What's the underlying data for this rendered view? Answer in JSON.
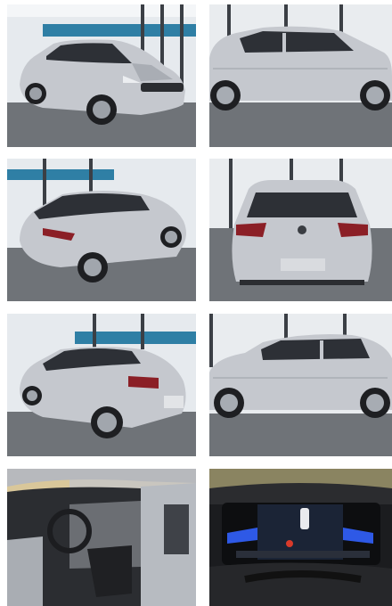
{
  "gallery": {
    "photos": [
      {
        "view": "front-left"
      },
      {
        "view": "side-right"
      },
      {
        "view": "rear-left"
      },
      {
        "view": "rear"
      },
      {
        "view": "rear-left-close"
      },
      {
        "view": "side-left"
      },
      {
        "view": "interior-driver-door"
      },
      {
        "view": "instrument-cluster"
      }
    ],
    "colors": {
      "car_silver": "#c3c6cc",
      "car_shadow": "#8e939b",
      "showroom_wall": "#e9ecef",
      "blue_band": "#2f7fa5",
      "floor": "#6f7378",
      "tyre": "#1e1f22"
    }
  }
}
